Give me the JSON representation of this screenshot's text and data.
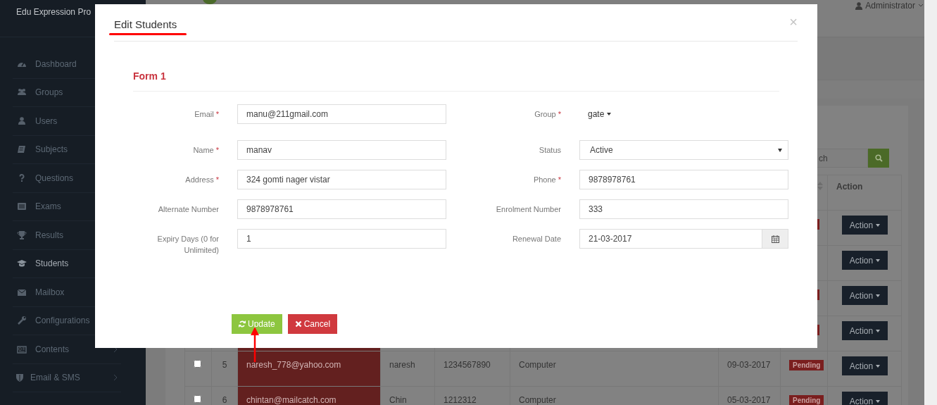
{
  "sidebar": {
    "brand": "Edu Expression Pro",
    "items": [
      {
        "label": "Dashboard",
        "selected": false,
        "submenu": false
      },
      {
        "label": "Groups",
        "selected": false,
        "submenu": false
      },
      {
        "label": "Users",
        "selected": false,
        "submenu": false
      },
      {
        "label": "Subjects",
        "selected": false,
        "submenu": false
      },
      {
        "label": "Questions",
        "selected": false,
        "submenu": false
      },
      {
        "label": "Exams",
        "selected": false,
        "submenu": false
      },
      {
        "label": "Results",
        "selected": false,
        "submenu": false
      },
      {
        "label": "Students",
        "selected": true,
        "submenu": false
      },
      {
        "label": "Mailbox",
        "selected": false,
        "submenu": false
      },
      {
        "label": "Configurations",
        "selected": false,
        "submenu": false
      },
      {
        "label": "Contents",
        "selected": false,
        "submenu": true
      },
      {
        "label": "Email & SMS",
        "selected": false,
        "submenu": true
      }
    ]
  },
  "top_bar": {
    "user": "Administrator"
  },
  "table": {
    "search": {
      "placeholder": "ch"
    },
    "columns": [
      {
        "label": "Action"
      }
    ],
    "rows": [
      {
        "status_badge": true,
        "action": "Action"
      },
      {
        "status_badge": false,
        "action": "Action"
      },
      {
        "status_badge": true,
        "action": "Action"
      },
      {
        "status_badge": true,
        "action": "Action"
      },
      {
        "checked": false,
        "number": "5",
        "email": "naresh_778@yahoo.com",
        "name": "naresh",
        "phone": "1234567890",
        "subject": "Computer",
        "date": "09-03-2017",
        "status": "Pending",
        "action": "Action"
      },
      {
        "checked": false,
        "number": "6",
        "email": "chintan@mailcatch.com",
        "name": "Chin",
        "phone": "1212312",
        "subject": "Computer",
        "date": "05-03-2017",
        "status": "Pending",
        "action": "Action"
      }
    ]
  },
  "modal": {
    "title": "Edit Students",
    "close": "×",
    "section": "Form 1",
    "fields": [
      {
        "kind": "input",
        "label": "Email",
        "mark": "*",
        "value": "manu@211gmail.com"
      },
      {
        "kind": "dropdown",
        "label": "Group",
        "mark": "*",
        "value": "gate"
      },
      {
        "kind": "input",
        "label": "Name",
        "mark": "*",
        "value": "manav"
      },
      {
        "kind": "select",
        "label": "Status",
        "value": "Active"
      },
      {
        "kind": "input",
        "label": "Address",
        "mark": "*",
        "value": "324 gomti nager vistar"
      },
      {
        "kind": "input",
        "label": "Phone",
        "mark": "*",
        "value": "9878978761"
      },
      {
        "kind": "input",
        "label": "Alternate Number",
        "value": "9878978761"
      },
      {
        "kind": "input",
        "label": "Enrolment Number",
        "value": "333"
      },
      {
        "kind": "input",
        "label": "Expiry Days (0 for Unlimited)",
        "value": "1"
      },
      {
        "kind": "date",
        "label": "Renewal Date",
        "value": "21-03-2017"
      }
    ],
    "buttons": [
      {
        "kind": "update",
        "label": "Update"
      },
      {
        "kind": "cancel",
        "label": "Cancel"
      }
    ]
  }
}
